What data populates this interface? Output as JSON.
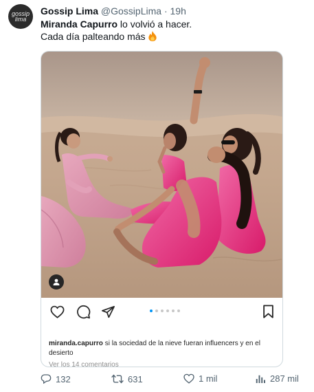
{
  "tweet": {
    "avatar_text_line1": "gossip",
    "avatar_text_line2": "lima",
    "author_name": "Gossip Lima",
    "handle": "@GossipLima",
    "separator": "·",
    "time": "19h",
    "text_bold": "Miranda Capurro",
    "text_rest": " lo volvió a hacer.",
    "text_line2": "Cada día palteando más",
    "emoji_icon": "fire-icon"
  },
  "instagram_card": {
    "carousel_pages": 6,
    "carousel_active_index": 0,
    "caption_user": "miranda.capurro",
    "caption_text": " si la sociedad de la nieve fueran influencers y en el desierto",
    "comments_link": "Ver los 14 comentarios",
    "colors": {
      "accent_blue": "#0095f6",
      "dress_pink": "#e8257a",
      "sand": "#c9ad92"
    }
  },
  "footer": {
    "replies": "132",
    "retweets": "631",
    "likes": "1 mil",
    "views": "287 mil"
  }
}
